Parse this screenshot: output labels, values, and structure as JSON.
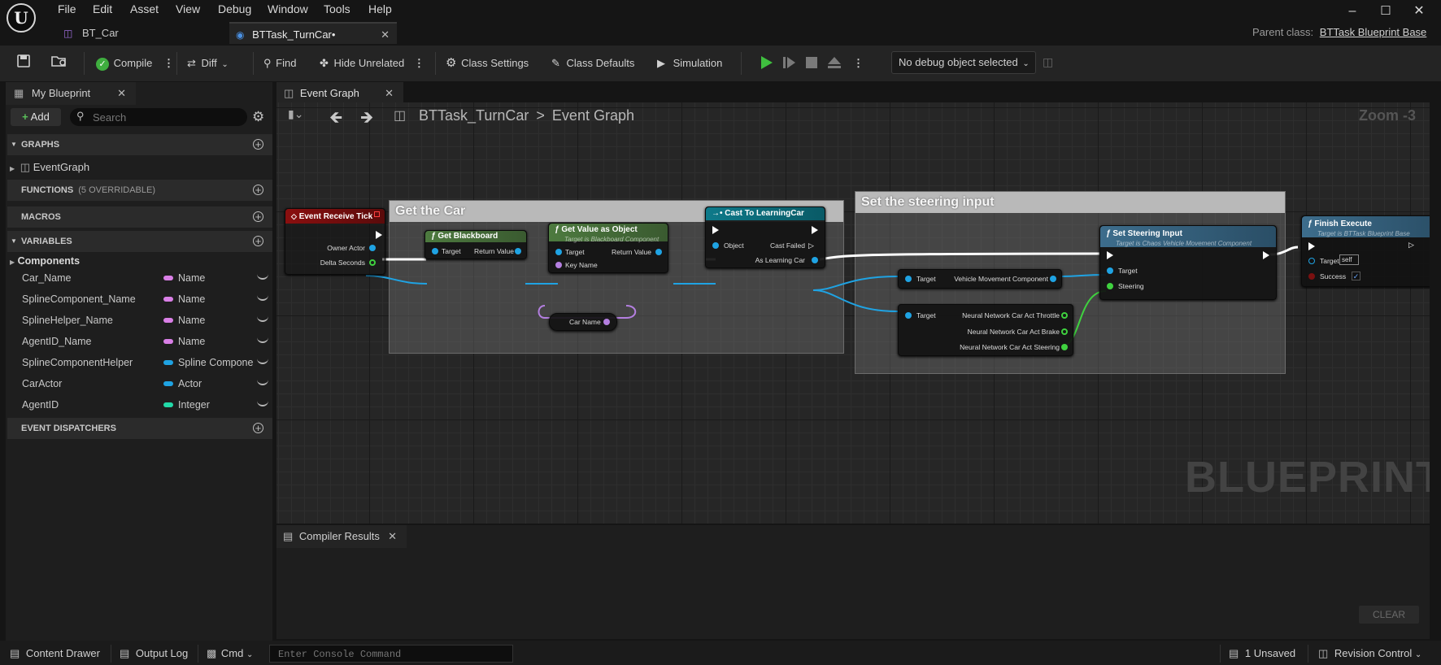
{
  "menu": [
    "File",
    "Edit",
    "Asset",
    "View",
    "Debug",
    "Window",
    "Tools",
    "Help"
  ],
  "doc_tabs": [
    {
      "label": "BT_Car"
    },
    {
      "label": "BTTask_TurnCar•"
    }
  ],
  "parent_class": {
    "label": "Parent class:",
    "value": "BTTask Blueprint Base"
  },
  "toolbar": {
    "compile": "Compile",
    "diff": "Diff",
    "find": "Find",
    "hide_unrelated": "Hide Unrelated",
    "class_settings": "Class Settings",
    "class_defaults": "Class Defaults",
    "simulation": "Simulation",
    "debug_object": "No debug object selected"
  },
  "my_blueprint": {
    "tab": "My Blueprint",
    "add": "Add",
    "search_placeholder": "Search",
    "sections": {
      "graphs": "GRAPHS",
      "functions": "FUNCTIONS",
      "functions_note": "(5 OVERRIDABLE)",
      "macros": "MACROS",
      "variables": "VARIABLES",
      "event_dispatchers": "EVENT DISPATCHERS"
    },
    "graph_item": "EventGraph",
    "components": "Components",
    "variables": [
      {
        "name": "Car_Name",
        "type": "Name",
        "color": "#d97fe6"
      },
      {
        "name": "SplineComponent_Name",
        "type": "Name",
        "color": "#d97fe6"
      },
      {
        "name": "SplineHelper_Name",
        "type": "Name",
        "color": "#d97fe6"
      },
      {
        "name": "AgentID_Name",
        "type": "Name",
        "color": "#d97fe6"
      },
      {
        "name": "SplineComponentHelper",
        "type": "Spline Component",
        "color": "#1fa3e3"
      },
      {
        "name": "CarActor",
        "type": "Actor",
        "color": "#1fa3e3"
      },
      {
        "name": "AgentID",
        "type": "Integer",
        "color": "#22d9a8"
      }
    ]
  },
  "graph": {
    "tab": "Event Graph",
    "breadcrumb_root": "BTTask_TurnCar",
    "breadcrumb_sep": ">",
    "breadcrumb_leaf": "Event Graph",
    "zoom": "Zoom -3",
    "watermark": "BLUEPRINT",
    "comments": {
      "get_car": "Get the Car",
      "set_steering": "Set the steering input"
    },
    "nodes": {
      "event_tick": {
        "title": "Event Receive Tick",
        "pins": [
          "Owner Actor",
          "Delta Seconds"
        ]
      },
      "get_blackboard": {
        "title": "Get Blackboard",
        "pins": [
          "Target",
          "Return Value"
        ]
      },
      "get_value": {
        "title": "Get Value as Object",
        "subtitle": "Target is Blackboard Component",
        "pins": [
          "Target",
          "Return Value",
          "Key Name"
        ]
      },
      "car_name": {
        "label": "Car Name"
      },
      "cast": {
        "title": "Cast To LearningCar",
        "pins": [
          "Object",
          "Cast Failed",
          "As Learning Car"
        ]
      },
      "vmc": {
        "pins": [
          "Target",
          "Vehicle Movement Component"
        ]
      },
      "nn": {
        "pins": [
          "Target",
          "Neural Network Car Act Throttle",
          "Neural Network Car Act Brake",
          "Neural Network Car Act Steering"
        ]
      },
      "set_steering": {
        "title": "Set Steering Input",
        "subtitle": "Target is Chaos Vehicle Movement Component",
        "pins": [
          "Target",
          "Steering"
        ]
      },
      "finish": {
        "title": "Finish Execute",
        "subtitle": "Target is BTTask Blueprint Base",
        "pins": [
          "Target",
          "Success"
        ],
        "target_value": "self"
      }
    }
  },
  "compiler": {
    "tab": "Compiler Results",
    "clear": "CLEAR"
  },
  "status_bar": {
    "content_drawer": "Content Drawer",
    "output_log": "Output Log",
    "cmd": "Cmd",
    "console_placeholder": "Enter Console Command",
    "unsaved": "1 Unsaved",
    "revision_control": "Revision Control"
  }
}
